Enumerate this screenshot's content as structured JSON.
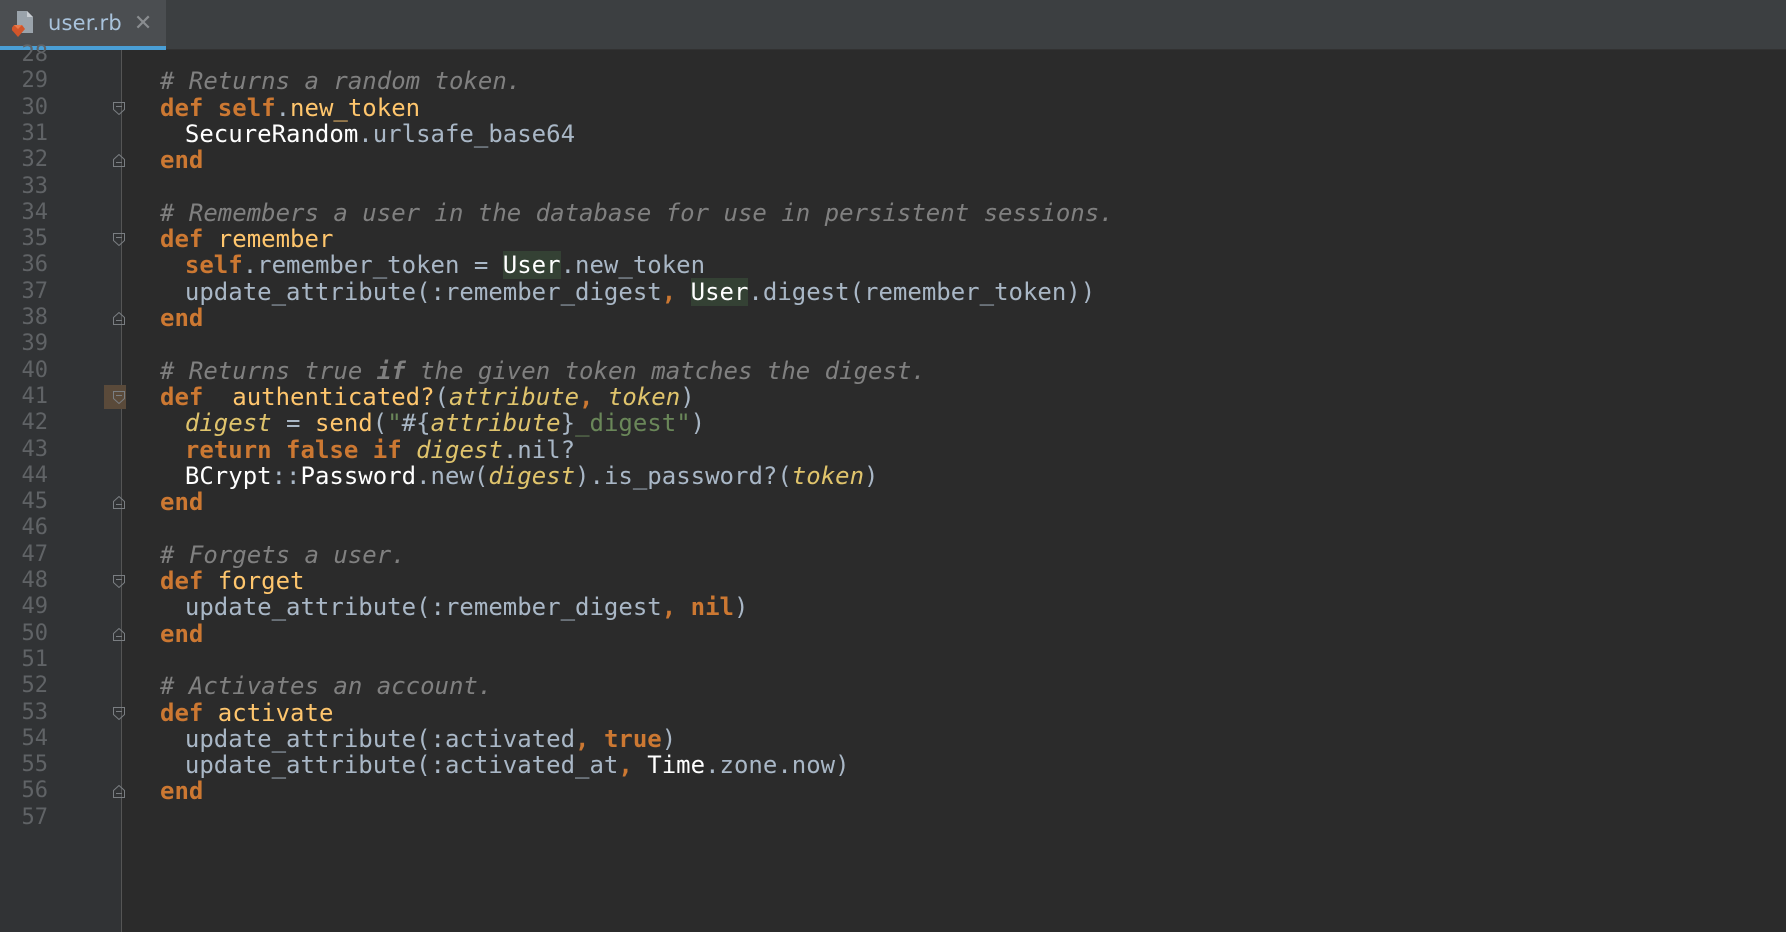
{
  "tab": {
    "filename": "user.rb",
    "close_glyph": "✕",
    "icon": "ruby-file-icon"
  },
  "lines": [
    {
      "n": "28"
    },
    {
      "n": "29",
      "tokens": [
        [
          "cm",
          "# Returns a random token."
        ]
      ]
    },
    {
      "n": "30",
      "fold": "open",
      "tokens": [
        [
          "kw",
          "def "
        ],
        [
          "kw",
          "self"
        ],
        [
          "",
          "."
        ],
        [
          "fn",
          "new_token"
        ]
      ]
    },
    {
      "n": "31",
      "indent": 1,
      "tokens": [
        [
          "cst",
          "SecureRandom"
        ],
        [
          "",
          "."
        ],
        [
          "",
          "urlsafe_base64"
        ]
      ]
    },
    {
      "n": "32",
      "fold": "close",
      "tokens": [
        [
          "kw",
          "end"
        ]
      ]
    },
    {
      "n": "33"
    },
    {
      "n": "34",
      "tokens": [
        [
          "cm",
          "# Remembers a user in the database for use in persistent sessions."
        ]
      ]
    },
    {
      "n": "35",
      "fold": "open",
      "tokens": [
        [
          "kw",
          "def "
        ],
        [
          "fn",
          "remember"
        ]
      ]
    },
    {
      "n": "36",
      "indent": 1,
      "tokens": [
        [
          "kw",
          "self"
        ],
        [
          "",
          "."
        ],
        [
          "",
          "remember_token = "
        ],
        [
          "usr",
          "User"
        ],
        [
          "",
          "."
        ],
        [
          "",
          "new_token"
        ]
      ]
    },
    {
      "n": "37",
      "indent": 1,
      "tokens": [
        [
          "",
          "update_attribute("
        ],
        [
          "sym",
          ":remember_digest"
        ],
        [
          "kw",
          ", "
        ],
        [
          "usr",
          "User"
        ],
        [
          "",
          "."
        ],
        [
          "",
          "digest(remember_token))"
        ]
      ]
    },
    {
      "n": "38",
      "fold": "close",
      "tokens": [
        [
          "kw",
          "end"
        ]
      ]
    },
    {
      "n": "39"
    },
    {
      "n": "40",
      "tokens": [
        [
          "cm",
          "# Returns true "
        ],
        [
          "cm b",
          "if"
        ],
        [
          "cm",
          " the given token matches the digest."
        ]
      ]
    },
    {
      "n": "41",
      "fold": "open",
      "warn": true,
      "tokens": [
        [
          "kw",
          "def  "
        ],
        [
          "fn",
          "authenticated?"
        ],
        [
          "",
          "("
        ],
        [
          "prm",
          "attribute"
        ],
        [
          "kw",
          ", "
        ],
        [
          "prm",
          "token"
        ],
        [
          "",
          ")"
        ]
      ]
    },
    {
      "n": "42",
      "indent": 1,
      "tokens": [
        [
          "prm",
          "digest"
        ],
        [
          "",
          " = "
        ],
        [
          "fn",
          "send"
        ],
        [
          "",
          "("
        ],
        [
          "str",
          "\""
        ],
        [
          "",
          "#{"
        ],
        [
          "prm",
          "attribute"
        ],
        [
          "",
          "}"
        ],
        [
          "str",
          "_digest\""
        ],
        [
          "",
          ")"
        ]
      ]
    },
    {
      "n": "43",
      "indent": 1,
      "tokens": [
        [
          "kw",
          "return "
        ],
        [
          "kw",
          "false "
        ],
        [
          "kw",
          "if "
        ],
        [
          "prm",
          "digest"
        ],
        [
          "",
          "."
        ],
        [
          "",
          "nil?"
        ]
      ]
    },
    {
      "n": "44",
      "indent": 1,
      "tokens": [
        [
          "cst",
          "BCrypt"
        ],
        [
          "",
          "::"
        ],
        [
          "cst",
          "Password"
        ],
        [
          "",
          "."
        ],
        [
          "",
          "new("
        ],
        [
          "prm",
          "digest"
        ],
        [
          "",
          ")."
        ],
        [
          "",
          "is_password?("
        ],
        [
          "prm",
          "token"
        ],
        [
          "",
          ")"
        ]
      ]
    },
    {
      "n": "45",
      "fold": "close",
      "tokens": [
        [
          "kw",
          "end"
        ]
      ]
    },
    {
      "n": "46"
    },
    {
      "n": "47",
      "tokens": [
        [
          "cm",
          "# Forgets a user."
        ]
      ]
    },
    {
      "n": "48",
      "fold": "open",
      "tokens": [
        [
          "kw",
          "def "
        ],
        [
          "fn",
          "forget"
        ]
      ]
    },
    {
      "n": "49",
      "indent": 1,
      "tokens": [
        [
          "",
          "update_attribute("
        ],
        [
          "sym",
          ":remember_digest"
        ],
        [
          "kw",
          ", "
        ],
        [
          "kw",
          "nil"
        ],
        [
          "",
          ")"
        ]
      ]
    },
    {
      "n": "50",
      "fold": "close",
      "tokens": [
        [
          "kw",
          "end"
        ]
      ]
    },
    {
      "n": "51"
    },
    {
      "n": "52",
      "tokens": [
        [
          "cm",
          "# Activates an account."
        ]
      ]
    },
    {
      "n": "53",
      "fold": "open",
      "tokens": [
        [
          "kw",
          "def "
        ],
        [
          "fn",
          "activate"
        ]
      ]
    },
    {
      "n": "54",
      "indent": 1,
      "tokens": [
        [
          "",
          "update_attribute("
        ],
        [
          "sym",
          ":activated"
        ],
        [
          "kw",
          ", "
        ],
        [
          "kw",
          "true"
        ],
        [
          "",
          ")"
        ]
      ]
    },
    {
      "n": "55",
      "indent": 1,
      "tokens": [
        [
          "",
          "update_attribute("
        ],
        [
          "sym",
          ":activated_at"
        ],
        [
          "kw",
          ", "
        ],
        [
          "cst",
          "Time"
        ],
        [
          "",
          "."
        ],
        [
          "",
          "zone"
        ],
        [
          "",
          "."
        ],
        [
          "",
          "now)"
        ]
      ]
    },
    {
      "n": "56",
      "fold": "close",
      "tokens": [
        [
          "kw",
          "end"
        ]
      ]
    },
    {
      "n": "57"
    }
  ]
}
